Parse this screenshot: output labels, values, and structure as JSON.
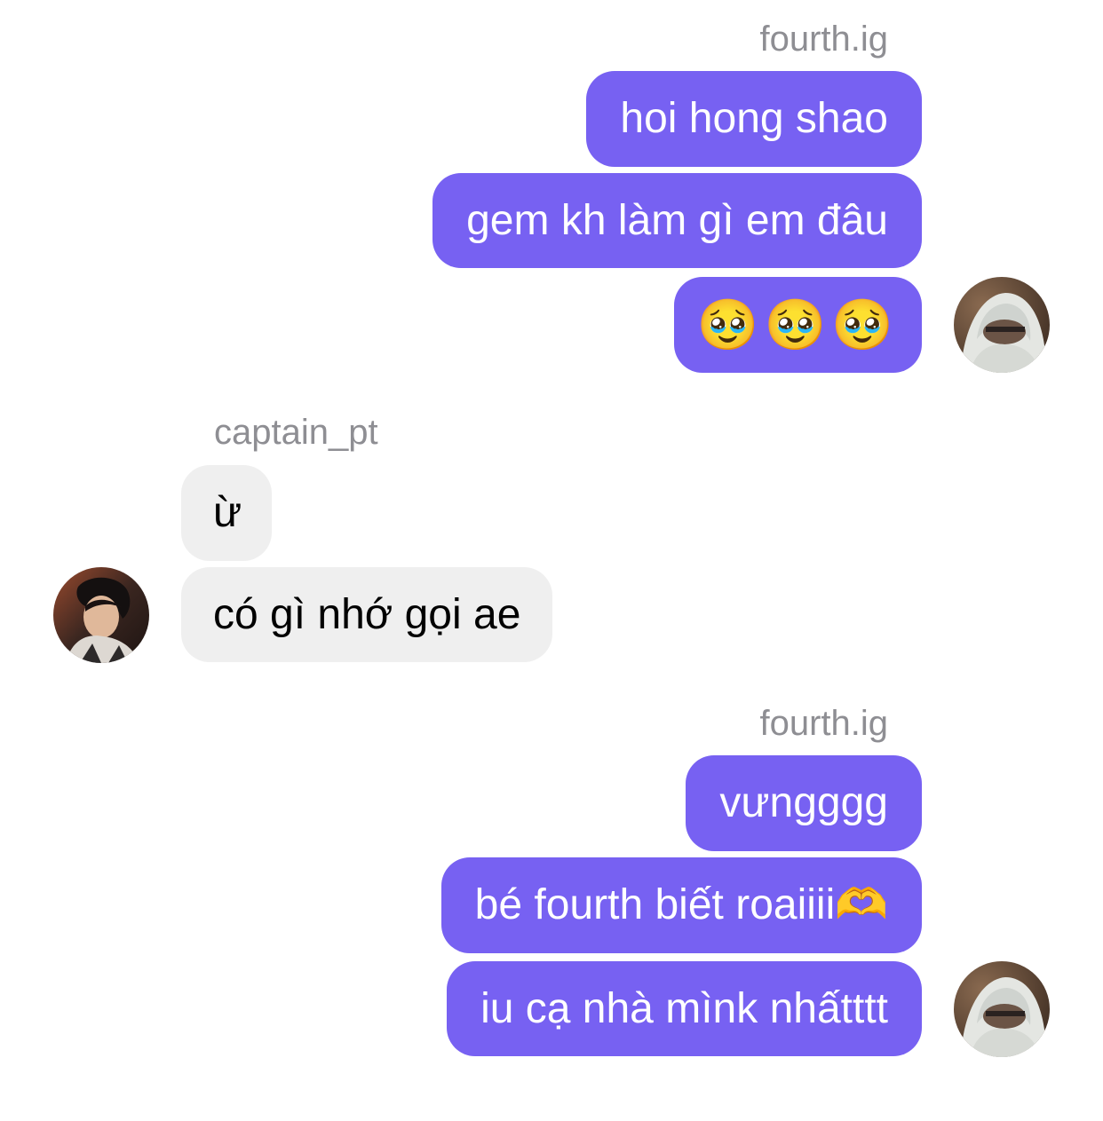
{
  "groups": [
    {
      "sender": "fourth.ig",
      "messages": [
        "hoi hong shao",
        "gem kh làm gì em đâu",
        "🥹🥹🥹"
      ]
    },
    {
      "sender": "captain_pt",
      "messages": [
        "ừ",
        "có gì nhớ gọi ae"
      ]
    },
    {
      "sender": "fourth.ig",
      "messages": [
        "vưngggg",
        "bé fourth biết roaiiii🫶",
        "iu cạ nhà mìnk nhấtttt"
      ]
    }
  ],
  "colors": {
    "outgoing_bubble": "#7761f2",
    "incoming_bubble": "#efefef",
    "username_text": "#8e8e93"
  },
  "icons": {
    "avatar_fourth": "avatar-photo-hoodie",
    "avatar_captain": "avatar-photo-profile"
  }
}
